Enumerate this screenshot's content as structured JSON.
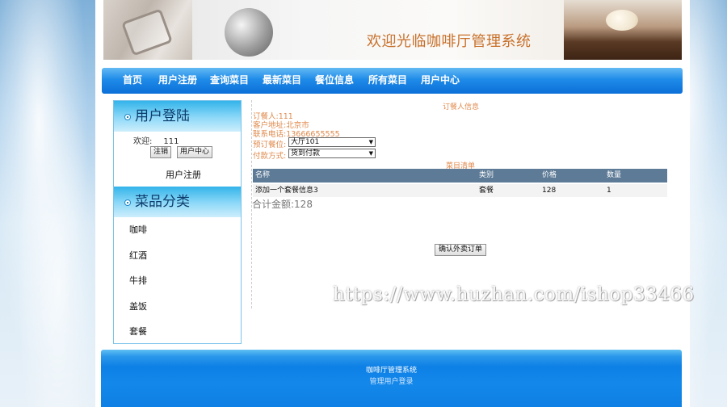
{
  "banner": {
    "title": "欢迎光临咖啡厅管理系统"
  },
  "nav": {
    "items": [
      "首页",
      "用户注册",
      "查询菜目",
      "最新菜目",
      "餐位信息",
      "所有菜目",
      "用户中心"
    ]
  },
  "sidebar": {
    "login_title": "用户登陆",
    "welcome_label": "欢迎:",
    "username": "111",
    "logout_label": "注销",
    "user_center_label": "用户中心",
    "register_label": "用户注册",
    "category_title": "菜品分类",
    "categories": [
      "咖啡",
      "红酒",
      "牛排",
      "盖饭",
      "套餐"
    ]
  },
  "order": {
    "section_title": "订餐人信息",
    "name_label": "订餐人:",
    "name_value": "111",
    "address_label": "客户地址:",
    "address_value": "北京市",
    "phone_label": "联系电话:",
    "phone_value": "13666655555",
    "seat_label": "预订餐位:",
    "seat_value": "大厅101",
    "payment_label": "付款方式:",
    "payment_value": "货到付款",
    "menu_title": "菜目清单",
    "columns": [
      "名称",
      "类别",
      "价格",
      "数量"
    ],
    "rows": [
      {
        "name": "添加一个套餐信息3",
        "category": "套餐",
        "price": "128",
        "qty": "1"
      }
    ],
    "total_label": "合计金额:",
    "total_value": "128",
    "confirm_label": "确认外卖订单"
  },
  "watermark": "https://www.huzhan.com/ishop33466",
  "footer": {
    "title": "咖啡厅管理系统",
    "admin_link": "管理用户登录"
  }
}
